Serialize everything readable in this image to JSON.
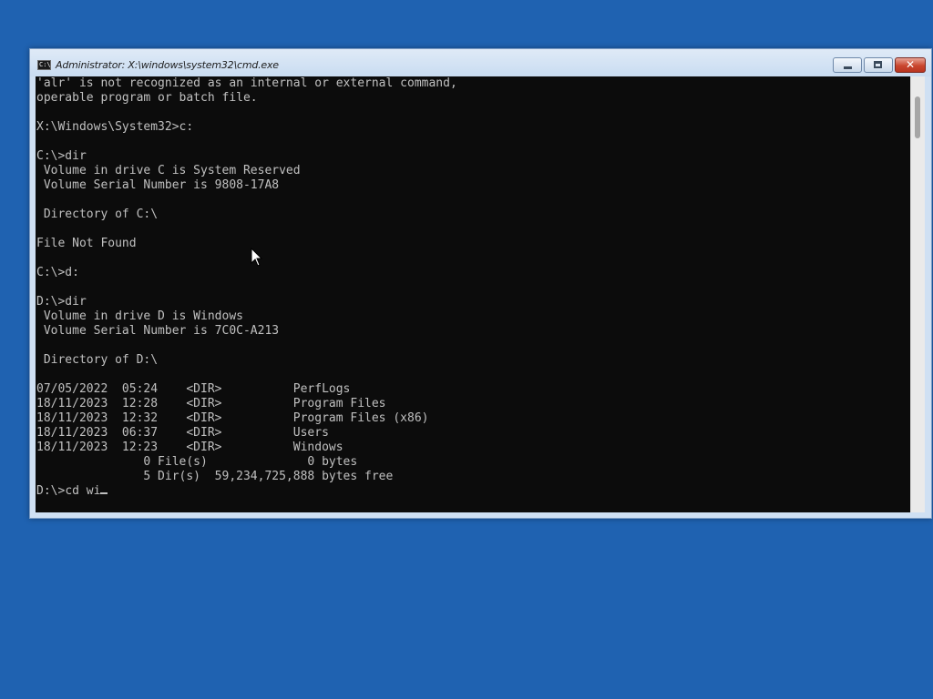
{
  "window": {
    "title": "Administrator: X:\\windows\\system32\\cmd.exe",
    "icon": "cmd-icon",
    "icon_text": "C:\\",
    "controls": {
      "minimize": "minimize-icon",
      "maximize": "maximize-icon",
      "close": "close-icon",
      "close_glyph": "✕"
    }
  },
  "console": {
    "text_color": "#c0c0c0",
    "background": "#0c0c0c",
    "output": "'alr' is not recognized as an internal or external command,\noperable program or batch file.\n\nX:\\Windows\\System32>c:\n\nC:\\>dir\n Volume in drive C is System Reserved\n Volume Serial Number is 9808-17A8\n\n Directory of C:\\\n\nFile Not Found\n\nC:\\>d:\n\nD:\\>dir\n Volume in drive D is Windows\n Volume Serial Number is 7C0C-A213\n\n Directory of D:\\\n\n07/05/2022  05:24    <DIR>          PerfLogs\n18/11/2023  12:28    <DIR>          Program Files\n18/11/2023  12:32    <DIR>          Program Files (x86)\n18/11/2023  06:37    <DIR>          Users\n18/11/2023  12:23    <DIR>          Windows\n               0 File(s)              0 bytes\n               5 Dir(s)  59,234,725,888 bytes free\n",
    "prompt": "D:\\>",
    "current_input": "cd wi"
  },
  "desktop": {
    "background": "#1f62b1"
  }
}
